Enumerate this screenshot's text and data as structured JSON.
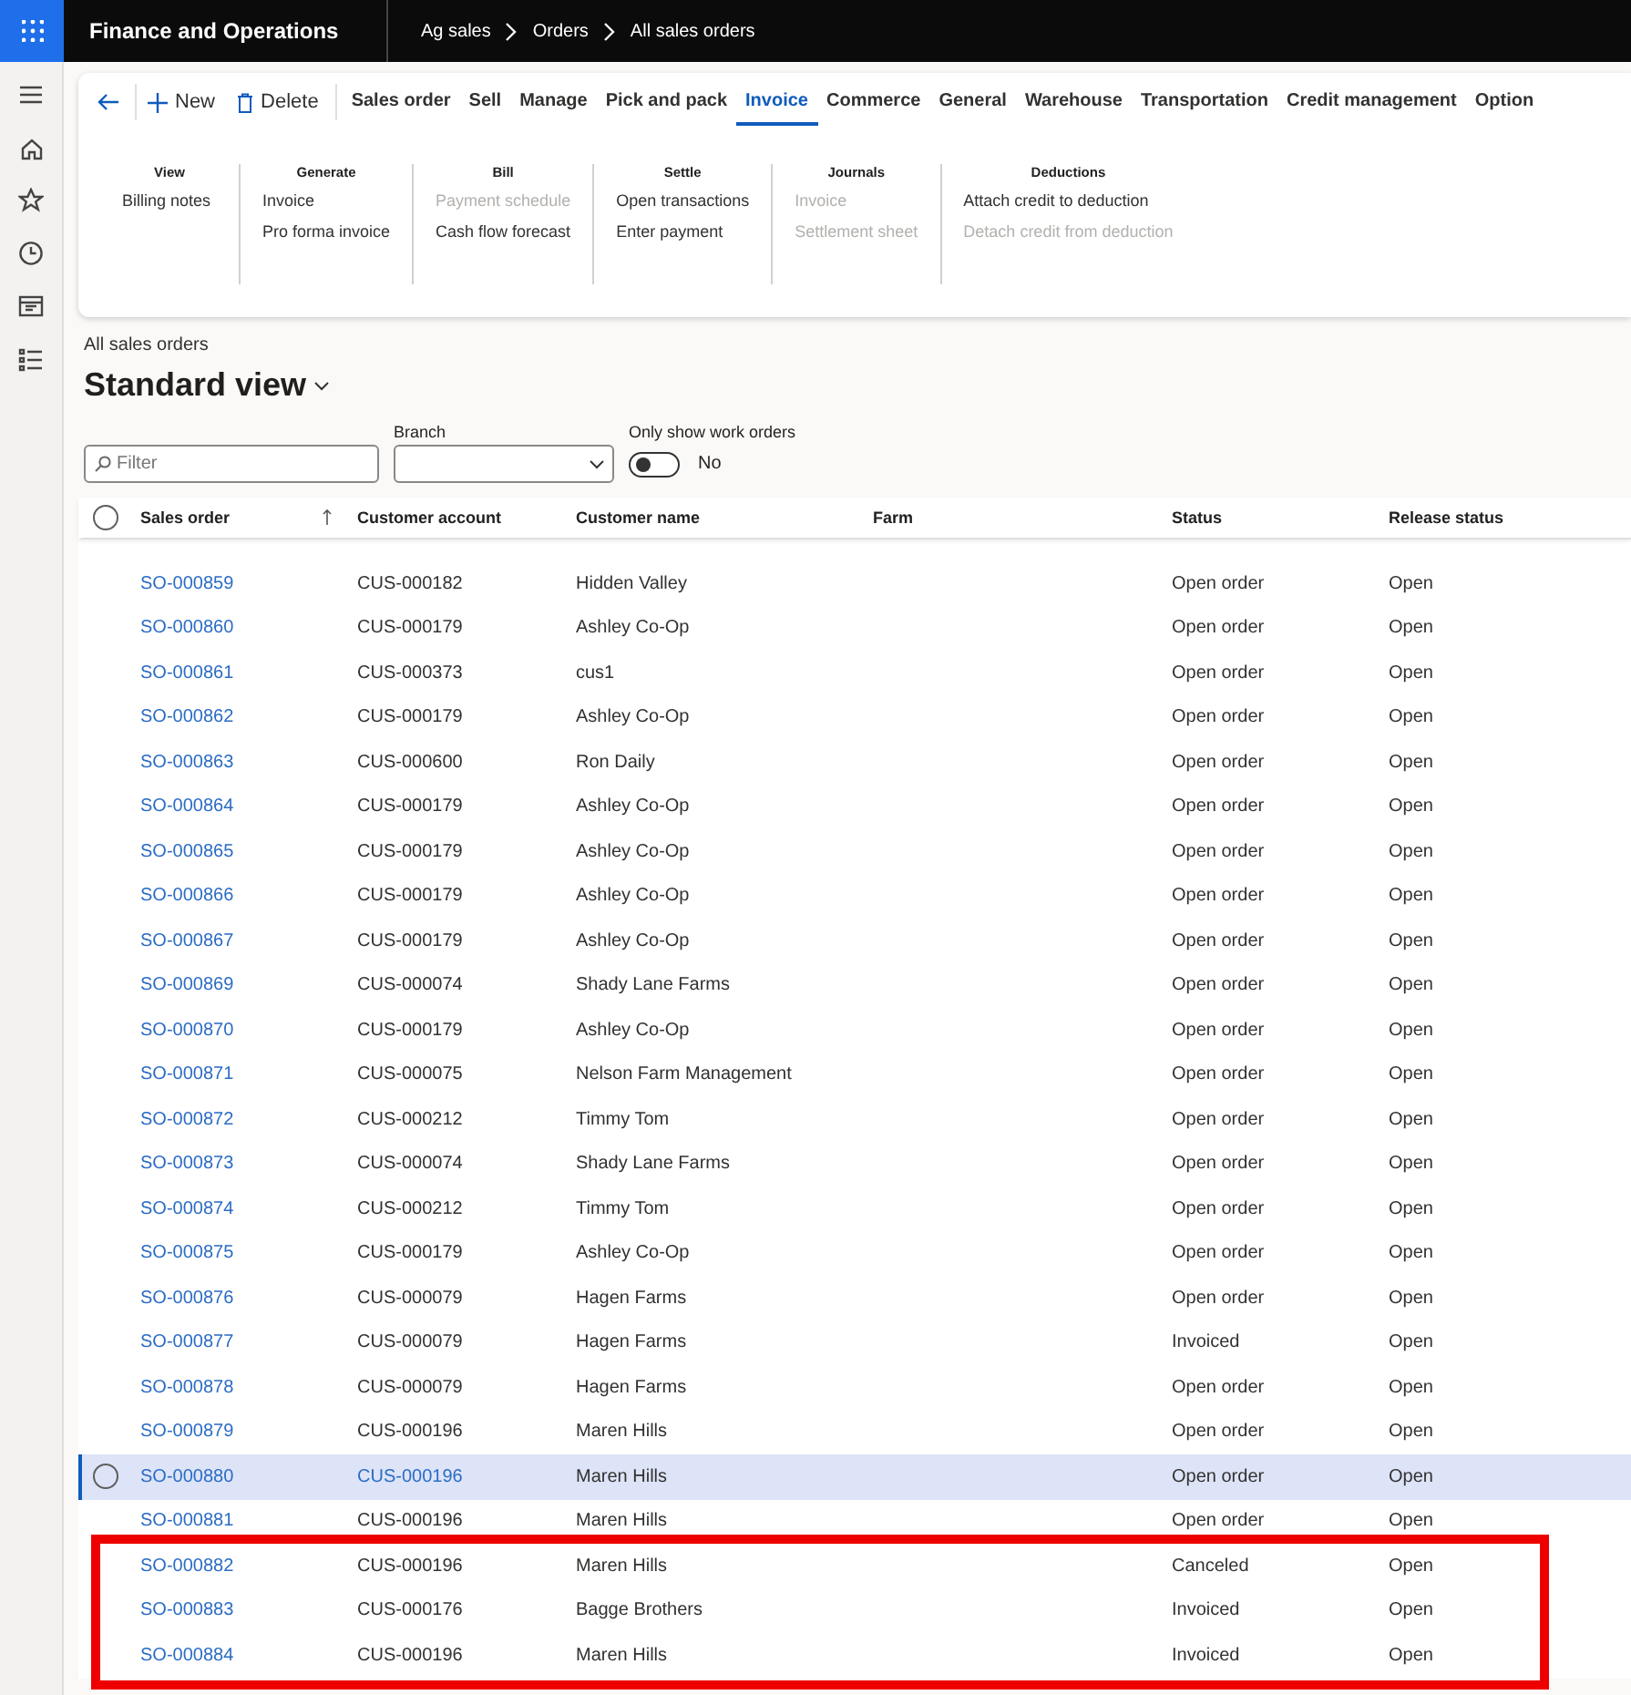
{
  "app": {
    "title": "Finance and Operations"
  },
  "breadcrumb": [
    "Ag sales",
    "Orders",
    "All sales orders"
  ],
  "action_bar": {
    "buttons": [
      {
        "kind": "new",
        "label": "New"
      },
      {
        "kind": "delete",
        "label": "Delete"
      }
    ],
    "tabs": [
      {
        "label": "Sales order",
        "selected": false
      },
      {
        "label": "Sell",
        "selected": false
      },
      {
        "label": "Manage",
        "selected": false
      },
      {
        "label": "Pick and pack",
        "selected": false
      },
      {
        "label": "Invoice",
        "selected": true
      },
      {
        "label": "Commerce",
        "selected": false
      },
      {
        "label": "General",
        "selected": false
      },
      {
        "label": "Warehouse",
        "selected": false
      },
      {
        "label": "Transportation",
        "selected": false
      },
      {
        "label": "Credit management",
        "selected": false
      },
      {
        "label": "Option",
        "selected": false
      }
    ]
  },
  "ribbon_groups": [
    {
      "title": "View",
      "items": [
        {
          "label": "Billing notes",
          "disabled": false
        }
      ]
    },
    {
      "title": "Generate",
      "items": [
        {
          "label": "Invoice",
          "disabled": false
        },
        {
          "label": "Pro forma invoice",
          "disabled": false
        }
      ]
    },
    {
      "title": "Bill",
      "items": [
        {
          "label": "Payment schedule",
          "disabled": true
        },
        {
          "label": "Cash flow forecast",
          "disabled": false
        }
      ]
    },
    {
      "title": "Settle",
      "items": [
        {
          "label": "Open transactions",
          "disabled": false
        },
        {
          "label": "Enter payment",
          "disabled": false
        }
      ]
    },
    {
      "title": "Journals",
      "items": [
        {
          "label": "Invoice",
          "disabled": true
        },
        {
          "label": "Settlement sheet",
          "disabled": true
        }
      ]
    },
    {
      "title": "Deductions",
      "items": [
        {
          "label": "Attach credit to deduction",
          "disabled": false
        },
        {
          "label": "Detach credit from deduction",
          "disabled": true
        }
      ]
    }
  ],
  "page": {
    "caption": "All sales orders",
    "view_title": "Standard view"
  },
  "filters": {
    "filter": {
      "placeholder": "Filter"
    },
    "branch": {
      "label": "Branch"
    },
    "work_orders": {
      "label": "Only show work orders",
      "on": false,
      "value_text": "No"
    }
  },
  "table": {
    "select_all": {
      "checked": false
    },
    "columns": [
      "Sales order",
      "Customer account",
      "Customer name",
      "Farm",
      "Status",
      "Release status"
    ],
    "rows": [
      {
        "order": "SO-000859",
        "account": "CUS-000182",
        "name": "Hidden Valley",
        "status": "Open order",
        "release": "Open",
        "selected": false,
        "highlighted": false
      },
      {
        "order": "SO-000860",
        "account": "CUS-000179",
        "name": "Ashley Co-Op",
        "status": "Open order",
        "release": "Open",
        "selected": false,
        "highlighted": false
      },
      {
        "order": "SO-000861",
        "account": "CUS-000373",
        "name": "cus1",
        "status": "Open order",
        "release": "Open",
        "selected": false,
        "highlighted": false
      },
      {
        "order": "SO-000862",
        "account": "CUS-000179",
        "name": "Ashley Co-Op",
        "status": "Open order",
        "release": "Open",
        "selected": false,
        "highlighted": false
      },
      {
        "order": "SO-000863",
        "account": "CUS-000600",
        "name": "Ron Daily",
        "status": "Open order",
        "release": "Open",
        "selected": false,
        "highlighted": false
      },
      {
        "order": "SO-000864",
        "account": "CUS-000179",
        "name": "Ashley Co-Op",
        "status": "Open order",
        "release": "Open",
        "selected": false,
        "highlighted": false
      },
      {
        "order": "SO-000865",
        "account": "CUS-000179",
        "name": "Ashley Co-Op",
        "status": "Open order",
        "release": "Open",
        "selected": false,
        "highlighted": false
      },
      {
        "order": "SO-000866",
        "account": "CUS-000179",
        "name": "Ashley Co-Op",
        "status": "Open order",
        "release": "Open",
        "selected": false,
        "highlighted": false
      },
      {
        "order": "SO-000867",
        "account": "CUS-000179",
        "name": "Ashley Co-Op",
        "status": "Open order",
        "release": "Open",
        "selected": false,
        "highlighted": false
      },
      {
        "order": "SO-000869",
        "account": "CUS-000074",
        "name": "Shady Lane Farms",
        "status": "Open order",
        "release": "Open",
        "selected": false,
        "highlighted": false
      },
      {
        "order": "SO-000870",
        "account": "CUS-000179",
        "name": "Ashley Co-Op",
        "status": "Open order",
        "release": "Open",
        "selected": false,
        "highlighted": false
      },
      {
        "order": "SO-000871",
        "account": "CUS-000075",
        "name": "Nelson Farm Management",
        "status": "Open order",
        "release": "Open",
        "selected": false,
        "highlighted": false
      },
      {
        "order": "SO-000872",
        "account": "CUS-000212",
        "name": "Timmy Tom",
        "status": "Open order",
        "release": "Open",
        "selected": false,
        "highlighted": false
      },
      {
        "order": "SO-000873",
        "account": "CUS-000074",
        "name": "Shady Lane Farms",
        "status": "Open order",
        "release": "Open",
        "selected": false,
        "highlighted": false
      },
      {
        "order": "SO-000874",
        "account": "CUS-000212",
        "name": "Timmy Tom",
        "status": "Open order",
        "release": "Open",
        "selected": false,
        "highlighted": false
      },
      {
        "order": "SO-000875",
        "account": "CUS-000179",
        "name": "Ashley Co-Op",
        "status": "Open order",
        "release": "Open",
        "selected": false,
        "highlighted": false
      },
      {
        "order": "SO-000876",
        "account": "CUS-000079",
        "name": "Hagen Farms",
        "status": "Open order",
        "release": "Open",
        "selected": false,
        "highlighted": false
      },
      {
        "order": "SO-000877",
        "account": "CUS-000079",
        "name": "Hagen Farms",
        "status": "Invoiced",
        "release": "Open",
        "selected": false,
        "highlighted": false
      },
      {
        "order": "SO-000878",
        "account": "CUS-000079",
        "name": "Hagen Farms",
        "status": "Open order",
        "release": "Open",
        "selected": false,
        "highlighted": false
      },
      {
        "order": "SO-000879",
        "account": "CUS-000196",
        "name": "Maren Hills",
        "status": "Open order",
        "release": "Open",
        "selected": false,
        "highlighted": false
      },
      {
        "order": "SO-000880",
        "account": "CUS-000196",
        "name": "Maren Hills",
        "status": "Open order",
        "release": "Open",
        "selected": true,
        "highlighted": false
      },
      {
        "order": "SO-000881",
        "account": "CUS-000196",
        "name": "Maren Hills",
        "status": "Open order",
        "release": "Open",
        "selected": false,
        "highlighted": false
      },
      {
        "order": "SO-000882",
        "account": "CUS-000196",
        "name": "Maren Hills",
        "status": "Canceled",
        "release": "Open",
        "selected": false,
        "highlighted": true
      },
      {
        "order": "SO-000883",
        "account": "CUS-000176",
        "name": "Bagge Brothers",
        "status": "Invoiced",
        "release": "Open",
        "selected": false,
        "highlighted": true
      },
      {
        "order": "SO-000884",
        "account": "CUS-000196",
        "name": "Maren Hills",
        "status": "Invoiced",
        "release": "Open",
        "selected": false,
        "highlighted": true
      }
    ]
  }
}
